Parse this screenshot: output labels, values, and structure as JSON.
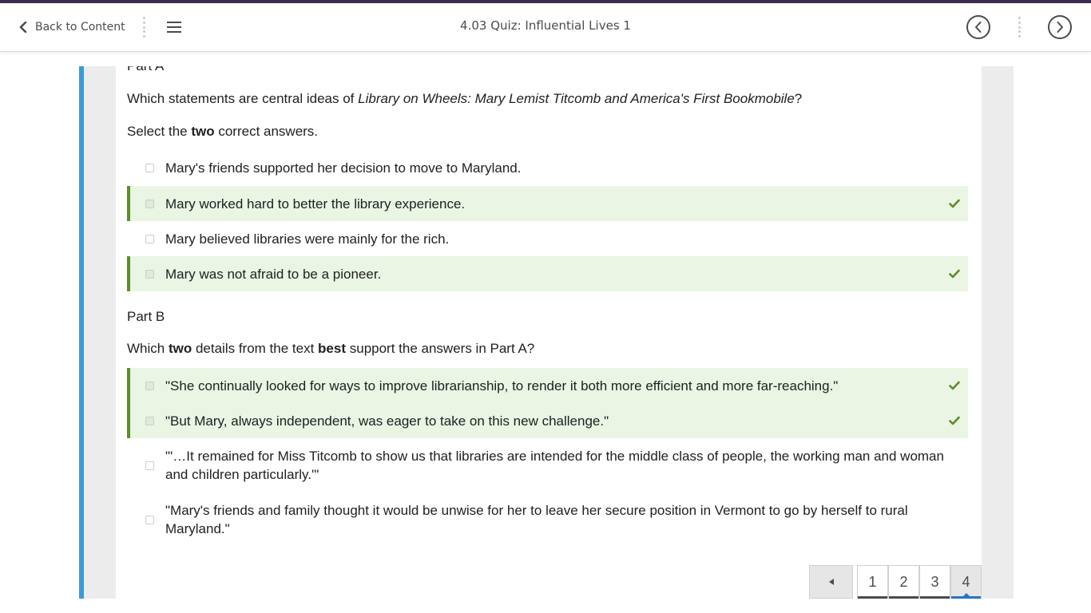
{
  "nav": {
    "back_label": "Back to Content",
    "title": "4.03 Quiz: Influential Lives 1",
    "menu_icon": "hamburger-icon",
    "prev_icon": "circle-chevron-left-icon",
    "next_icon": "circle-chevron-right-icon"
  },
  "colors": {
    "top_stripe": "#3c2b4f",
    "left_accent": "#3a9bd6",
    "correct_bg": "#eaf5e4",
    "correct_border": "#5c8d2a",
    "active_page_underline": "#2a74bf"
  },
  "part_a": {
    "title": "Part A",
    "question_prefix": "Which statements are central ideas of ",
    "question_italic": "Library on Wheels: Mary Lemist Titcomb and America's First Bookmobile",
    "question_suffix": "?",
    "instruction_prefix": "Select the ",
    "instruction_bold": "two",
    "instruction_suffix": " correct answers.",
    "options": [
      {
        "text": "Mary's friends supported her decision to move to Maryland.",
        "selected": false,
        "correct": false
      },
      {
        "text": "Mary worked hard to better the library experience.",
        "selected": true,
        "correct": true
      },
      {
        "text": "Mary believed libraries were mainly for the rich.",
        "selected": false,
        "correct": false
      },
      {
        "text": "Mary was not afraid to be a pioneer.",
        "selected": true,
        "correct": true
      }
    ]
  },
  "part_b": {
    "title": "Part B",
    "q_1": "Which ",
    "q_2": "two",
    "q_3": " details from the text ",
    "q_4": "best",
    "q_5": " support the answers in Part A?",
    "options": [
      {
        "text": "\"She continually looked for ways to improve librarianship, to render it both more efficient and more far-reaching.\"",
        "selected": true,
        "correct": true
      },
      {
        "text": "\"But Mary, always independent, was eager to take on this new challenge.\"",
        "selected": true,
        "correct": true
      },
      {
        "text": "\"'…It remained for Miss Titcomb to show us that libraries are intended for the middle class of people, the working man and woman and children particularly.'\"",
        "selected": false,
        "correct": false
      },
      {
        "text": "\"Mary's friends and family thought it would be unwise for her to leave her secure position in Vermont to go by herself to rural Maryland.\"",
        "selected": false,
        "correct": false
      }
    ]
  },
  "pagination": {
    "prev_icon": "triangle-left-icon",
    "pages": [
      "1",
      "2",
      "3",
      "4"
    ],
    "current": "4"
  }
}
